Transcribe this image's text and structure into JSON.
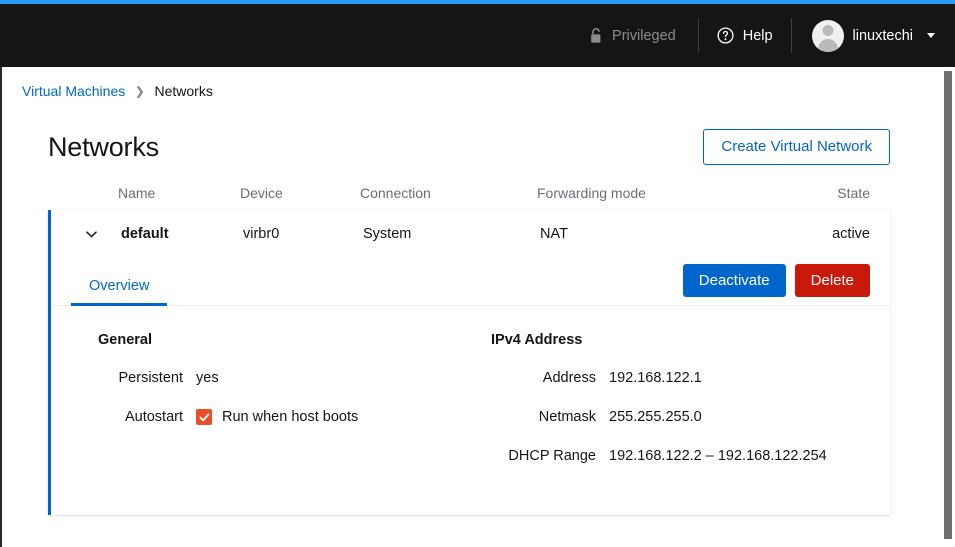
{
  "theme": {
    "accent_blue": "#06c",
    "top_accent": "#2b9af3",
    "masthead_bg": "#151515",
    "danger_red": "#c9190b",
    "checkbox_orange": "#e9502a"
  },
  "masthead": {
    "privileged_label": "Privileged",
    "privileged_icon": "unlock-icon",
    "help_label": "Help",
    "help_icon": "help-circle-icon",
    "user_name": "linuxtechi",
    "user_icon": "avatar-icon",
    "user_caret_icon": "caret-down-icon"
  },
  "breadcrumb": {
    "parent": "Virtual Machines",
    "separator_icon": "chevron-right-icon",
    "current": "Networks"
  },
  "page": {
    "title": "Networks",
    "create_button": "Create Virtual Network"
  },
  "table": {
    "columns": [
      "Name",
      "Device",
      "Connection",
      "Forwarding mode",
      "State"
    ],
    "rows": [
      {
        "toggle_icon": "chevron-down-icon",
        "name": "default",
        "device": "virbr0",
        "connection": "System",
        "forwarding_mode": "NAT",
        "state": "active"
      }
    ]
  },
  "expanded_row": {
    "tabs": [
      {
        "label": "Overview",
        "active": true
      }
    ],
    "actions": {
      "deactivate_label": "Deactivate",
      "delete_label": "Delete"
    },
    "general": {
      "heading": "General",
      "items": [
        {
          "term": "Persistent",
          "value": "yes"
        },
        {
          "term": "Autostart",
          "value": "Run when host boots",
          "checkbox": true
        }
      ]
    },
    "ipv4": {
      "heading": "IPv4 Address",
      "items": [
        {
          "term": "Address",
          "value": "192.168.122.1"
        },
        {
          "term": "Netmask",
          "value": "255.255.255.0"
        },
        {
          "term": "DHCP Range",
          "value": "192.168.122.2 – 192.168.122.254"
        }
      ]
    }
  }
}
